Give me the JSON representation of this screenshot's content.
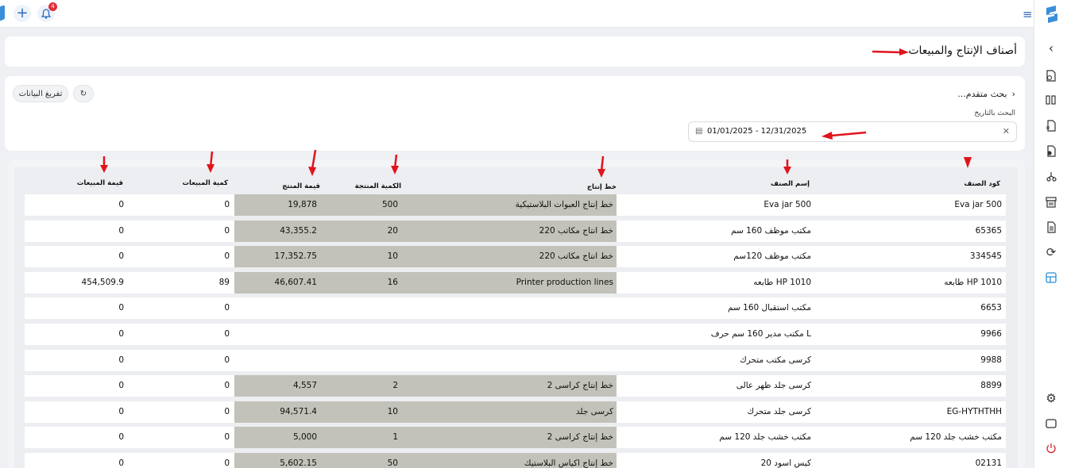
{
  "topbar": {
    "notification_count": "4",
    "add_icon": "plus-icon",
    "bell_icon": "bell-icon",
    "menu_icon": "hamburger-icon"
  },
  "page": {
    "title": "أصناف الإنتاج والمبيعات"
  },
  "filters": {
    "clear_button": "تفريغ البيانات",
    "refresh_icon": "refresh-icon",
    "advanced_search": "بحث متقدم...",
    "date_label": "البحث بالتاريخ",
    "date_range": "01/01/2025 - 12/31/2025"
  },
  "table": {
    "headers": {
      "code": "كود الصنف",
      "name": "إسم الصنف",
      "line": "خط إنتاج",
      "produced_qty": "الكمية المنتجة",
      "product_value": "قيمة المنتج",
      "sales_qty": "كمية المبيعات",
      "sales_value": "قيمة المبيعات"
    },
    "rows": [
      {
        "code": "Eva jar 500",
        "name": "Eva jar 500",
        "line": "خط إنتاج العبوات البلاستيكية",
        "qty": "500",
        "value": "19,878",
        "sales_qty": "0",
        "sales_value": "0"
      },
      {
        "code": "65365",
        "name": "مكتب موظف 160 سم",
        "line": "خط انتاج مكاتب 220",
        "qty": "20",
        "value": "43,355.2",
        "sales_qty": "0",
        "sales_value": "0"
      },
      {
        "code": "334545",
        "name": "مكتب موظف 120سم",
        "line": "خط انتاج مكاتب 220",
        "qty": "10",
        "value": "17,352.75",
        "sales_qty": "0",
        "sales_value": "0"
      },
      {
        "code": "طابعه HP 1010",
        "name": "طابعه HP 1010",
        "line": "Printer production lines",
        "qty": "16",
        "value": "46,607.41",
        "sales_qty": "89",
        "sales_value": "454,509.9"
      },
      {
        "code": "6653",
        "name": "مكتب استقبال 160 سم",
        "line": "",
        "qty": "",
        "value": "",
        "sales_qty": "0",
        "sales_value": "0"
      },
      {
        "code": "9966",
        "name": "مكتب مدير 160 سم حرف L",
        "line": "",
        "qty": "",
        "value": "",
        "sales_qty": "0",
        "sales_value": "0"
      },
      {
        "code": "9988",
        "name": "كرسى مكتب متحرك",
        "line": "",
        "qty": "",
        "value": "",
        "sales_qty": "0",
        "sales_value": "0"
      },
      {
        "code": "8899",
        "name": "كرسى جلد ظهر عالى",
        "line": "خط إنتاج كراسى 2",
        "qty": "2",
        "value": "4,557",
        "sales_qty": "0",
        "sales_value": "0"
      },
      {
        "code": "EG-HYTHTHH",
        "name": "كرسى جلد متحرك",
        "line": "كرسى جلد",
        "qty": "10",
        "value": "94,571.4",
        "sales_qty": "0",
        "sales_value": "0"
      },
      {
        "code": "مكتب خشب جلد 120 سم",
        "name": "مكتب خشب جلد 120 سم",
        "line": "خط إنتاج كراسى 2",
        "qty": "1",
        "value": "5,000",
        "sales_qty": "0",
        "sales_value": "0"
      },
      {
        "code": "02131",
        "name": "كيس اسود 20",
        "line": "خط إنتاج اكياس البلاستيك",
        "qty": "50",
        "value": "5,602.15",
        "sales_qty": "0",
        "sales_value": "0"
      }
    ]
  },
  "sidebar": {
    "items": [
      "chevron-left-icon",
      "doc-money-icon",
      "columns-icon",
      "doc-swap-icon",
      "doc-check-icon",
      "tree-icon",
      "archive-icon",
      "doc-list-icon",
      "cycle-icon",
      "layout-icon",
      "gear-icon",
      "window-icon",
      "power-icon"
    ]
  },
  "colors": {
    "accent": "#2b6cc0",
    "shade": "#c2c2ba",
    "arrow": "#e0141c",
    "power": "#d9303a"
  }
}
